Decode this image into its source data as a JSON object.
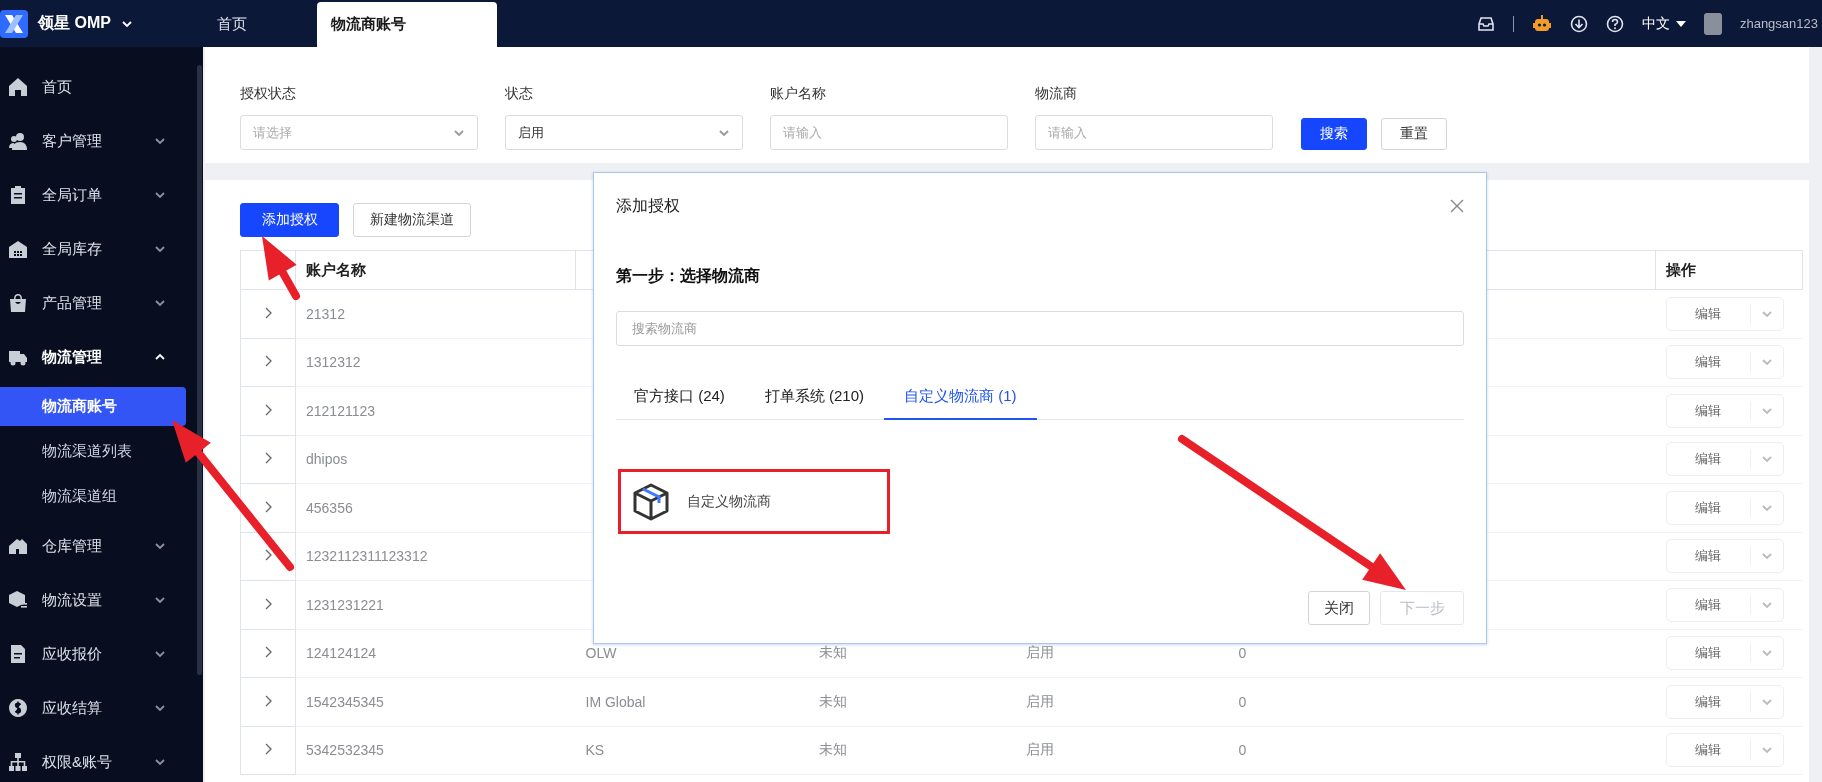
{
  "app": {
    "logo_text": "领星 OMP"
  },
  "top_tabs": [
    {
      "label": "首页",
      "selected": false
    },
    {
      "label": "物流商账号",
      "selected": true
    }
  ],
  "header": {
    "language": "中文",
    "username": "zhangsan123"
  },
  "sidebar": {
    "items": [
      {
        "label": "首页",
        "kind": "home"
      },
      {
        "label": "客户管理",
        "kind": "users",
        "expanded": false
      },
      {
        "label": "全局订单",
        "kind": "clipboard",
        "expanded": false
      },
      {
        "label": "全局库存",
        "kind": "warehouse",
        "expanded": false
      },
      {
        "label": "产品管理",
        "kind": "bag",
        "expanded": false
      },
      {
        "label": "物流管理",
        "kind": "truck",
        "expanded": true,
        "children": [
          {
            "label": "物流商账号",
            "selected": true
          },
          {
            "label": "物流渠道列表",
            "selected": false
          },
          {
            "label": "物流渠道组",
            "selected": false
          }
        ]
      },
      {
        "label": "仓库管理",
        "kind": "house",
        "expanded": false
      },
      {
        "label": "物流设置",
        "kind": "cube",
        "expanded": false
      },
      {
        "label": "应收报价",
        "kind": "document",
        "expanded": false
      },
      {
        "label": "应收结算",
        "kind": "coin",
        "expanded": false
      },
      {
        "label": "权限&账号",
        "kind": "sitemap",
        "expanded": false
      }
    ]
  },
  "filters": [
    {
      "label": "授权状态",
      "kind": "select",
      "placeholder": "请选择"
    },
    {
      "label": "状态",
      "kind": "select",
      "value": "启用"
    },
    {
      "label": "账户名称",
      "kind": "input",
      "placeholder": "请输入"
    },
    {
      "label": "物流商",
      "kind": "input",
      "placeholder": "请输入"
    }
  ],
  "filter_buttons": [
    {
      "label": "搜索",
      "kind": "primary"
    },
    {
      "label": "重置",
      "kind": "default"
    }
  ],
  "toolbar_buttons": [
    {
      "label": "添加授权",
      "kind": "primary"
    },
    {
      "label": "新建物流渠道",
      "kind": "default"
    }
  ],
  "table": {
    "columns": {
      "account_name": "账户名称",
      "actions": "操作"
    },
    "rows": [
      {
        "account_name": "21312",
        "action": "编辑"
      },
      {
        "account_name": "1312312",
        "action": "编辑"
      },
      {
        "account_name": "212121123",
        "action": "编辑"
      },
      {
        "account_name": "dhipos",
        "action": "编辑"
      },
      {
        "account_name": "456356",
        "action": "编辑"
      },
      {
        "account_name": "1232112311123312",
        "action": "编辑"
      },
      {
        "account_name": "1231231221",
        "action": "编辑"
      },
      {
        "account_name": "124124124",
        "column_2": "OLW",
        "column_3": "未知",
        "column_4": "启用",
        "column_5": "0",
        "action": "编辑"
      },
      {
        "account_name": "1542345345",
        "column_2": "IM Global",
        "column_3": "未知",
        "column_4": "启用",
        "column_5": "0",
        "action": "编辑"
      },
      {
        "account_name": "5342532345",
        "column_2": "KS",
        "column_3": "未知",
        "column_4": "启用",
        "column_5": "0",
        "action": "编辑"
      }
    ]
  },
  "modal": {
    "title": "添加授权",
    "step_title": "第一步：选择物流商",
    "search_placeholder": "搜索物流商",
    "tabs": [
      {
        "label": "官方接口 (24)",
        "selected": false
      },
      {
        "label": "打单系统 (210)",
        "selected": false
      },
      {
        "label": "自定义物流商 (1)",
        "selected": true
      }
    ],
    "carriers": [
      {
        "name": "自定义物流商"
      }
    ],
    "buttons": [
      {
        "label": "关闭",
        "disabled": false
      },
      {
        "label": "下一步",
        "disabled": true
      }
    ]
  }
}
